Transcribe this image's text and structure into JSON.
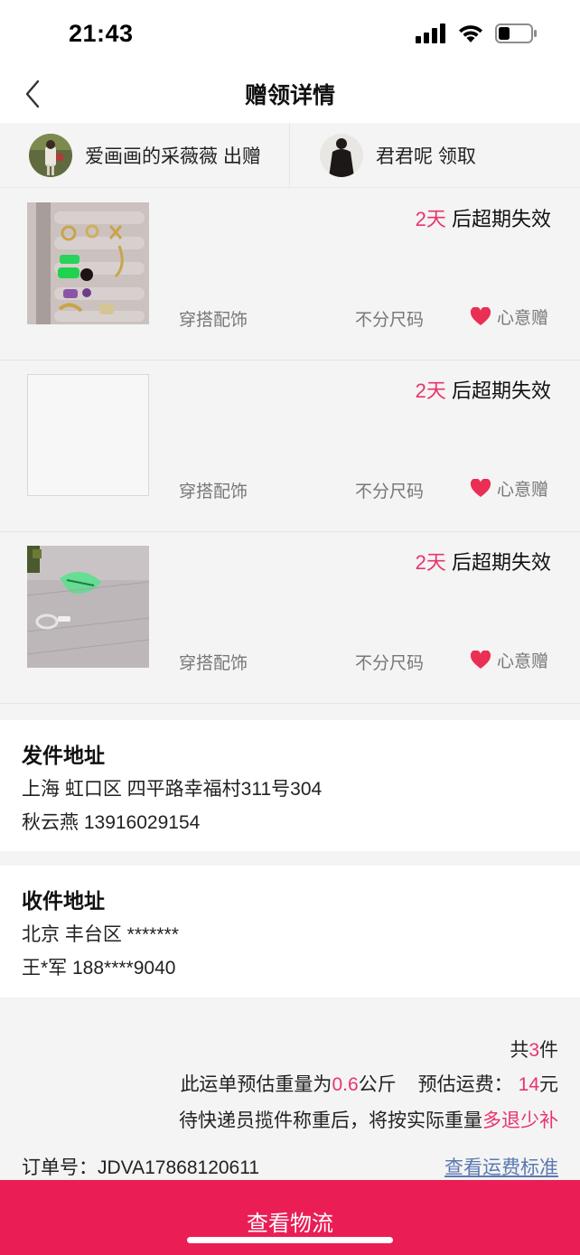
{
  "status_bar": {
    "time": "21:43"
  },
  "nav": {
    "title": "赠领详情"
  },
  "giver": {
    "text": "爱画画的采薇薇 出赠"
  },
  "receiver": {
    "text": "君君呢 领取"
  },
  "items": [
    {
      "days": "2天",
      "expire_suffix": " 后超期失效",
      "category": "穿搭配饰",
      "size": "不分尺码",
      "gift_label": "心意赠"
    },
    {
      "days": "2天",
      "expire_suffix": " 后超期失效",
      "category": "穿搭配饰",
      "size": "不分尺码",
      "gift_label": "心意赠"
    },
    {
      "days": "2天",
      "expire_suffix": " 后超期失效",
      "category": "穿搭配饰",
      "size": "不分尺码",
      "gift_label": "心意赠"
    }
  ],
  "sender_address": {
    "title": "发件地址",
    "address": "上海 虹口区 四平路幸福村311号304",
    "contact": "秋云燕 13916029154"
  },
  "receiver_address": {
    "title": "收件地址",
    "address": "北京 丰台区 *******",
    "contact": "王*军 188****9040"
  },
  "summary": {
    "count_prefix": "共",
    "count": "3",
    "count_suffix": "件",
    "weight_prefix": "此运单预估重量为",
    "weight": "0.6",
    "weight_unit": "公斤",
    "fee_label": "预估运费：",
    "fee": "14",
    "fee_unit": "元",
    "note_prefix": "待快递员揽件称重后，将按实际重量",
    "note_highlight": "多退少补",
    "order_label": "订单号：",
    "order_number": "JDVA17868120611",
    "fee_standard_link": "查看运费标准"
  },
  "bottom_button": {
    "label": "查看物流"
  },
  "colors": {
    "accent": "#ea1e55",
    "highlight": "#e8356b",
    "link": "#5b78b0"
  }
}
